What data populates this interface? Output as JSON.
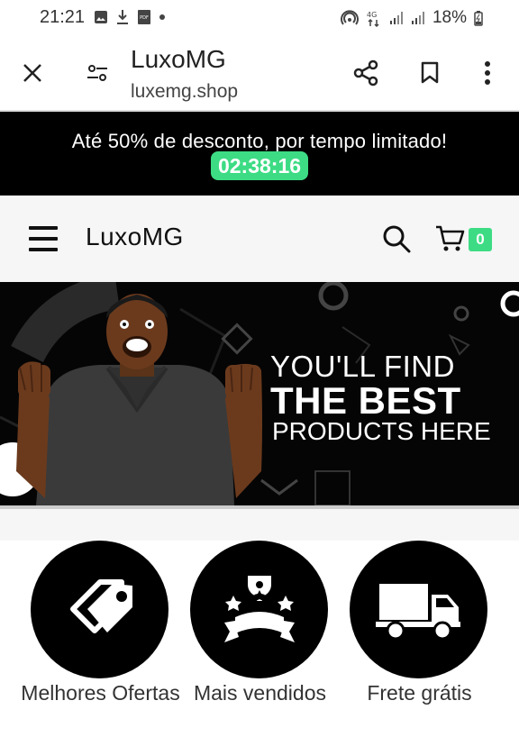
{
  "status_bar": {
    "time": "21:21",
    "battery": "18%"
  },
  "browser": {
    "site_title": "LuxoMG",
    "site_url": "luxemg.shop"
  },
  "promo": {
    "text": "Até 50% de desconto, por tempo limitado!",
    "timer": "02:38:16"
  },
  "store_header": {
    "logo": "LuxoMG",
    "cart_count": "0"
  },
  "banner": {
    "line1": "YOU'LL FIND",
    "line2": "THE BEST",
    "line3": "PRODUCTS HERE"
  },
  "categories": [
    {
      "label": "Melhores Ofertas",
      "icon": "tag-icon"
    },
    {
      "label": "Mais vendidos",
      "icon": "trophy-icon"
    },
    {
      "label": "Frete grátis",
      "icon": "truck-icon"
    }
  ],
  "colors": {
    "accent": "#3ddc84",
    "banner_bg": "#050505"
  }
}
